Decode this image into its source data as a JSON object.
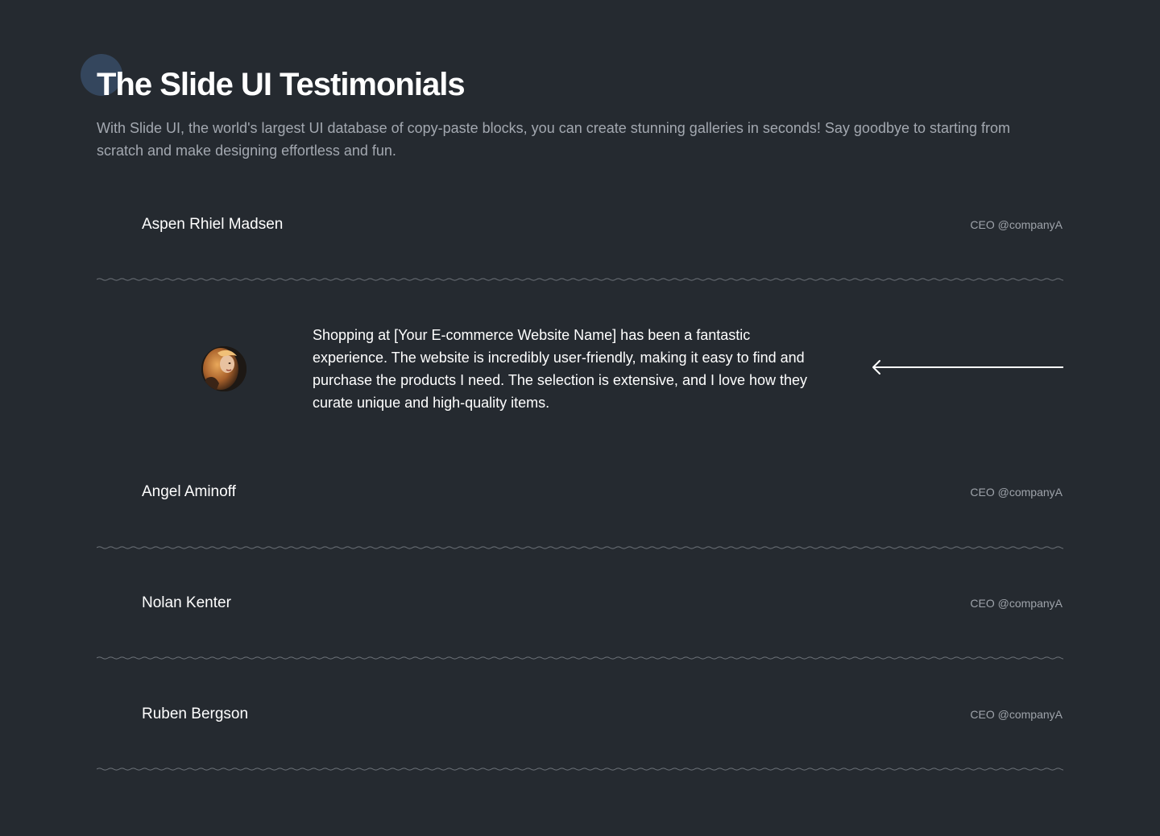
{
  "header": {
    "title": "The Slide UI Testimonials",
    "subtitle": "With Slide UI, the world's largest UI database of copy-paste blocks, you can create stunning galleries in seconds! Say goodbye to starting from scratch and make designing effortless and fun."
  },
  "testimonials": [
    {
      "name": "Aspen Rhiel Madsen",
      "role": "CEO @companyA"
    },
    {
      "name": "Angel Aminoff",
      "role": "CEO @companyA"
    },
    {
      "name": "Nolan Kenter",
      "role": "CEO @companyA"
    },
    {
      "name": "Ruben Bergson",
      "role": "CEO @companyA"
    }
  ],
  "expanded": {
    "quote": "Shopping at [Your E-commerce Website Name] has been a fantastic experience. The website is incredibly user-friendly, making it easy to find and purchase the products I need. The selection is extensive, and I love how they curate unique and high-quality items.",
    "avatar_icon": "user-avatar-photo",
    "arrow_icon": "arrow-left-icon"
  },
  "colors": {
    "background": "#252a30",
    "accent_dot": "#34465d",
    "divider": "#6f747b",
    "muted_text": "#a3a8b0"
  }
}
